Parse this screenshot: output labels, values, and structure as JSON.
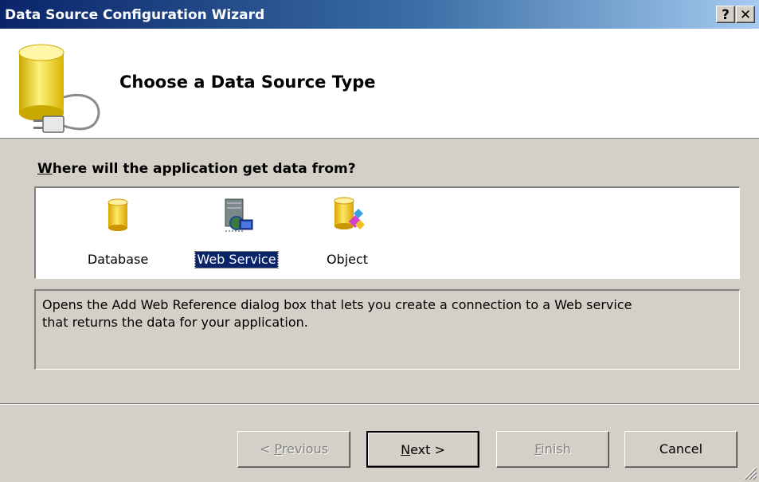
{
  "window": {
    "title": "Data Source Configuration Wizard",
    "help_label": "?",
    "close_label": "✕"
  },
  "header": {
    "title": "Choose a Data Source Type",
    "icon": "database-plug-icon"
  },
  "prompt": {
    "mnemonic": "W",
    "rest": "here will the application get data from?"
  },
  "sources": {
    "items": [
      {
        "label": "Database",
        "icon": "database-icon",
        "selected": false
      },
      {
        "label": "Web Service",
        "icon": "web-service-icon",
        "selected": true
      },
      {
        "label": "Object",
        "icon": "object-icon",
        "selected": false
      }
    ]
  },
  "description": {
    "line1": "Opens the Add Web Reference dialog box that lets you create a connection to a Web service",
    "line2": "that returns the data for your application."
  },
  "buttons": {
    "previous": {
      "before": "< ",
      "mnemonic": "P",
      "after": "revious",
      "enabled": false
    },
    "next": {
      "mnemonic": "N",
      "after": "ext >",
      "enabled": true
    },
    "finish": {
      "mnemonic": "F",
      "after": "inish",
      "enabled": false
    },
    "cancel": {
      "label": "Cancel",
      "enabled": true
    }
  },
  "colors": {
    "titlebar_start": "#0a246a",
    "titlebar_end": "#a6caf0",
    "selection": "#0a246a",
    "dialog_face": "#d4d0c8"
  }
}
